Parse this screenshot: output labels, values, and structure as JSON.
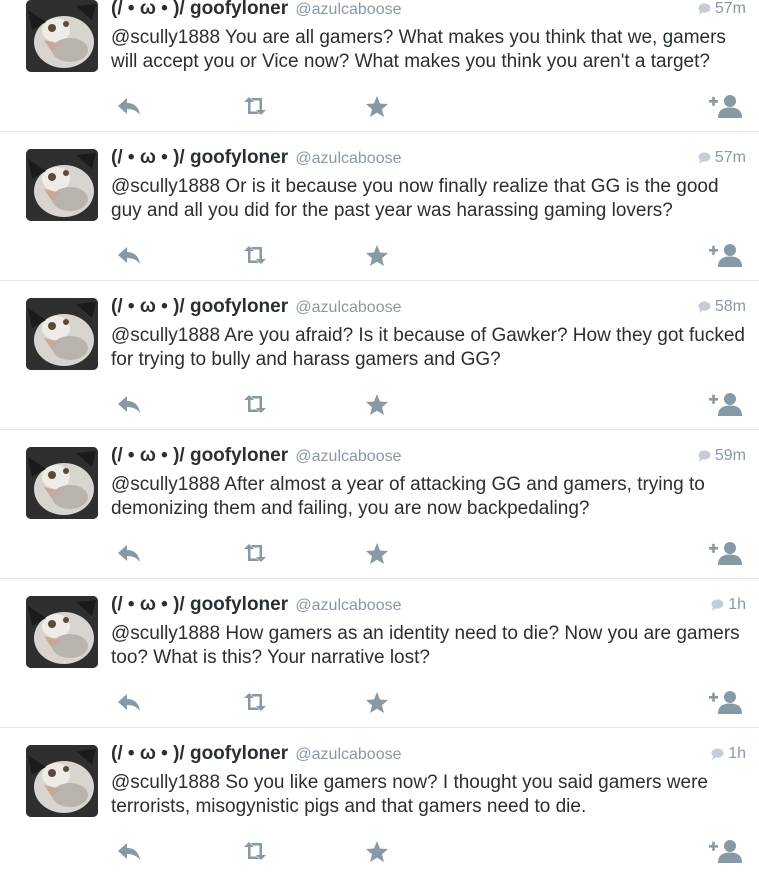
{
  "tweets": [
    {
      "fullname": "(/ • ω • )/ goofyloner",
      "screen_name": "@azulcaboose",
      "time": "57m",
      "text": "@scully1888 You are all gamers? What makes you think that we, gamers will accept you or Vice now? What makes you think you aren't a target?"
    },
    {
      "fullname": "(/ • ω • )/ goofyloner",
      "screen_name": "@azulcaboose",
      "time": "57m",
      "text": "@scully1888 Or is it because you now finally realize that GG is the good guy and all you did for the past year was harassing gaming lovers?"
    },
    {
      "fullname": "(/ • ω • )/ goofyloner",
      "screen_name": "@azulcaboose",
      "time": "58m",
      "text": "@scully1888 Are you afraid? Is it because of Gawker? How they got fucked for trying to bully and harass gamers and GG?"
    },
    {
      "fullname": "(/ • ω • )/ goofyloner",
      "screen_name": "@azulcaboose",
      "time": "59m",
      "text": "@scully1888 After almost a year of attacking GG and gamers, trying to demonizing them and failing, you are now backpedaling?"
    },
    {
      "fullname": "(/ • ω • )/ goofyloner",
      "screen_name": "@azulcaboose",
      "time": "1h",
      "text": "@scully1888 How gamers as an identity need to die? Now you are gamers too? What is this? Your narrative lost?"
    },
    {
      "fullname": "(/ • ω • )/ goofyloner",
      "screen_name": "@azulcaboose",
      "time": "1h",
      "text": "@scully1888 So you like gamers now? I thought you said gamers were terrorists, misogynistic pigs and that gamers need to die."
    }
  ],
  "icons": {
    "reply": "reply-icon",
    "retweet": "retweet-icon",
    "favorite": "star-icon",
    "follow": "follow-icon",
    "conversation": "speech-bubble-icon"
  },
  "colors": {
    "icon_gray": "#8899a6",
    "text": "#292f33",
    "divider": "#e1e8ed"
  }
}
